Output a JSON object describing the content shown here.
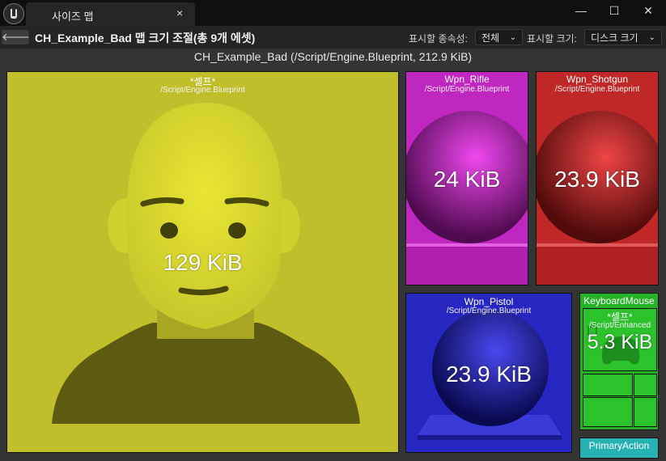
{
  "window": {
    "tab_label": "사이즈 맵",
    "tab_close": "×",
    "minimize": "—",
    "maximize": "☐",
    "close": "✕"
  },
  "toolbar": {
    "back_icon": "🡐",
    "title": "CH_Example_Bad 맵 크기 조절(총 9개 에셋)",
    "dependency_label": "표시할 종속성:",
    "dependency_value": "전체",
    "size_label": "표시할 크기:",
    "size_value": "디스크 크기"
  },
  "map": {
    "header": "CH_Example_Bad  (/Script/Engine.Blueprint, 212.9 KiB)",
    "blocks": {
      "self": {
        "name": "*셀프*",
        "path": "/Script/Engine.Blueprint",
        "size": "129 KiB",
        "color": "#c0bf2b"
      },
      "rifle": {
        "name": "Wpn_Rifle",
        "path": "/Script/Engine.Blueprint",
        "size": "24 KiB",
        "color": "#c026c0"
      },
      "shotgun": {
        "name": "Wpn_Shotgun",
        "path": "/Script/Engine.Blueprint",
        "size": "23.9 KiB",
        "color": "#c02727"
      },
      "pistol": {
        "name": "Wpn_Pistol",
        "path": "/Script/Engine.Blueprint",
        "size": "23.9 KiB",
        "color": "#2626c0"
      },
      "keyboard": {
        "name": "KeyboardMouse",
        "color": "#26b226"
      },
      "keyboard_self": {
        "name": "*셀프*",
        "path": "/Script/Enhanced",
        "size": "5.3 KiB"
      },
      "primary": {
        "name": "PrimaryAction",
        "color": "#26b2b2"
      }
    }
  }
}
